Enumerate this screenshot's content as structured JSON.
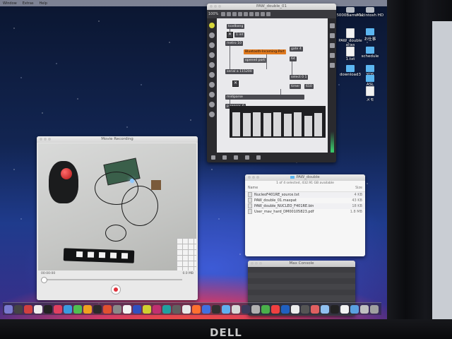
{
  "menubar": {
    "items": [
      "Window",
      "Extras",
      "Help"
    ]
  },
  "desktop_icons": [
    {
      "label": "5000Barrel 11",
      "kind": "drive"
    },
    {
      "label": "Macintosh HD",
      "kind": "drive"
    },
    {
      "label": "PAW_double alias",
      "kind": "doc"
    },
    {
      "label": "お仕事",
      "kind": "folder"
    },
    {
      "label": "1.txt",
      "kind": "doc"
    },
    {
      "label": "schedule",
      "kind": "folder"
    },
    {
      "label": "download3",
      "kind": "folder"
    },
    {
      "label": "YOS",
      "kind": "folder"
    },
    {
      "label": "ASL",
      "kind": "folder"
    },
    {
      "label": "メモ",
      "kind": "doc"
    }
  ],
  "patcher": {
    "title": "PAW_double_01",
    "zoom": "100%",
    "objects": {
      "loadbang": "loadbang",
      "toggle_label": "1 int",
      "metro": "metro 10",
      "port_menu": "Bluetooth-Incoming-Port",
      "open_port": "opened port",
      "serial": "serial a 115200",
      "gate": "gate 4",
      "gate_val": "64",
      "select": "select 0 1",
      "timer": "timer",
      "timer_val": "610",
      "midiparse": "midiparse",
      "sensor": "p sensor_6"
    },
    "slider_values": [
      0.82,
      0.8,
      0.84,
      0.8,
      0.82,
      0.78,
      0.84,
      0.7,
      0.8
    ]
  },
  "video": {
    "title": "Movie Recording",
    "time": "00:00:00",
    "size": "0.0 MB"
  },
  "finder": {
    "title": "PAW_double",
    "status": "1 of 4 selected, 432.91 GB available",
    "col_name": "Name",
    "col_size": "Size",
    "files": [
      {
        "name": "NucleoF401RE_source.txt",
        "size": "4 KB"
      },
      {
        "name": "PAW_double_01.maxpat",
        "size": "43 KB"
      },
      {
        "name": "PAW_double_NUCLEO_F401RE.bin",
        "size": "18 KB"
      },
      {
        "name": "User_mav_hard_DM00105823.pdf",
        "size": "1.8 MB"
      }
    ]
  },
  "console": {
    "title": "Max Console"
  },
  "brand": "DELL",
  "colors": {
    "accent_orange": "#e07a1f",
    "record_red": "#e0303a",
    "folder_blue": "#5cb6f0"
  }
}
